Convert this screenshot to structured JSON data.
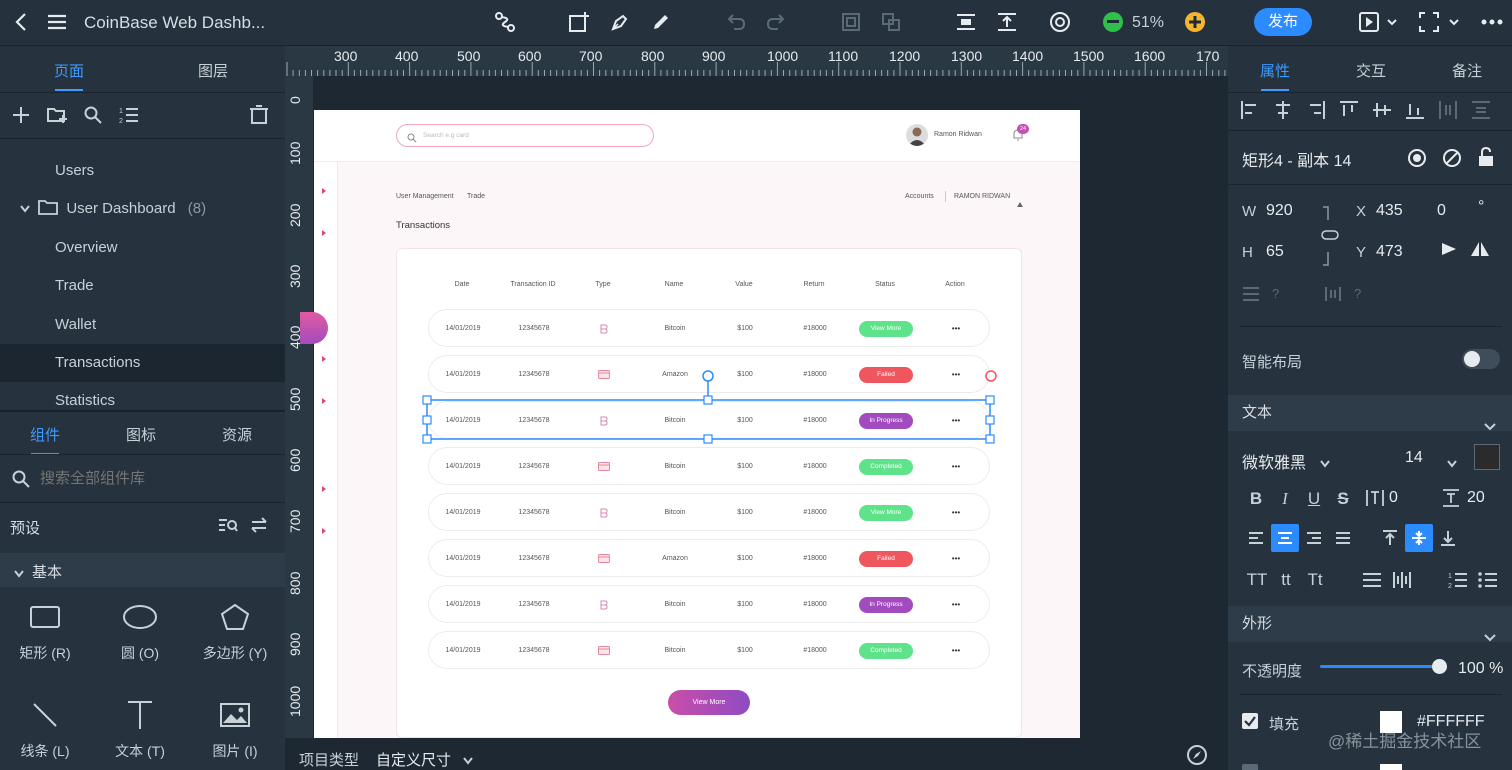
{
  "app": {
    "title": "CoinBase Web Dashb...",
    "zoom": "51%",
    "publish_label": "发布"
  },
  "left": {
    "tabs": [
      "页面",
      "图层"
    ],
    "pages": [
      {
        "label": "Users",
        "indent": 1
      },
      {
        "label": "User Dashboard",
        "count": "(8)",
        "folder": true
      },
      {
        "label": "Overview"
      },
      {
        "label": "Trade"
      },
      {
        "label": "Wallet"
      },
      {
        "label": "Transactions",
        "selected": true
      },
      {
        "label": "Statistics"
      }
    ],
    "lib_tabs": [
      "组件",
      "图标",
      "资源"
    ],
    "search_placeholder": "搜索全部组件库",
    "preset_label": "预设",
    "basic_label": "基本",
    "components": [
      {
        "label": "矩形 (R)",
        "icon": "rectangle-icon"
      },
      {
        "label": "圆 (O)",
        "icon": "ellipse-icon"
      },
      {
        "label": "多边形 (Y)",
        "icon": "polygon-icon"
      },
      {
        "label": "线条 (L)",
        "icon": "line-icon"
      },
      {
        "label": "文本 (T)",
        "icon": "text-icon"
      },
      {
        "label": "图片 (I)",
        "icon": "image-icon"
      }
    ]
  },
  "ruler": {
    "h": [
      "300",
      "400",
      "500",
      "600",
      "700",
      "800",
      "900",
      "1000",
      "1100",
      "1200",
      "1300",
      "1400",
      "1500",
      "1600",
      "170"
    ],
    "v": [
      "0",
      "100",
      "200",
      "300",
      "400",
      "500",
      "600",
      "700",
      "800",
      "900",
      "1000"
    ]
  },
  "bottom": {
    "project_type_label": "项目类型",
    "project_type_value": "自定义尺寸"
  },
  "right": {
    "tabs": [
      "属性",
      "交互",
      "备注"
    ],
    "layer_name": "矩形4 - 副本 14",
    "w_label": "W",
    "w": "920",
    "h_label": "H",
    "h": "65",
    "x_label": "X",
    "x": "435",
    "y_label": "Y",
    "y": "473",
    "rotation": "0",
    "rotation_unit": "°",
    "smart_layout": "智能布局",
    "text_section": "文本",
    "font_family": "微软雅黑",
    "font_size": "14",
    "letter_spacing": "0",
    "line_height": "20",
    "shape_section": "外形",
    "opacity_label": "不透明度",
    "opacity": "100 %",
    "opacity_fraction": 1.0,
    "fill_label": "填充",
    "fill_hex": "#FFFFFF",
    "watermark": "@稀土掘金技术社区"
  },
  "design": {
    "search_placeholder": "Search e.g card",
    "user_name": "Ramon Ridwan",
    "notif_count": "24",
    "breadcrumb_1": "User Management",
    "breadcrumb_2": "Trade",
    "accounts": "Accounts",
    "account_name": "RAMON RIDWAN",
    "section_title": "Transactions",
    "headers": [
      "Date",
      "Transaction ID",
      "Type",
      "Name",
      "Value",
      "Return",
      "Status",
      "Action"
    ],
    "rows": [
      {
        "date": "14/01/2019",
        "id": "12345678",
        "type": "bitcoin",
        "name": "Bitcoin",
        "value": "$100",
        "ret": "#18000",
        "status": "View More",
        "color": "#5ee38a"
      },
      {
        "date": "14/01/2019",
        "id": "12345678",
        "type": "card",
        "name": "Amazon",
        "value": "$100",
        "ret": "#18000",
        "status": "Failed",
        "color": "#f0565e"
      },
      {
        "date": "14/01/2019",
        "id": "12345678",
        "type": "bitcoin",
        "name": "Bitcoin",
        "value": "$100",
        "ret": "#18000",
        "status": "In Progress",
        "color": "#a24bbf"
      },
      {
        "date": "14/01/2019",
        "id": "12345678",
        "type": "card",
        "name": "Bitcoin",
        "value": "$100",
        "ret": "#18000",
        "status": "Completed",
        "color": "#5ee38a"
      },
      {
        "date": "14/01/2019",
        "id": "12345678",
        "type": "bitcoin",
        "name": "Bitcoin",
        "value": "$100",
        "ret": "#18000",
        "status": "View More",
        "color": "#5ee38a"
      },
      {
        "date": "14/01/2019",
        "id": "12345678",
        "type": "card",
        "name": "Amazon",
        "value": "$100",
        "ret": "#18000",
        "status": "Failed",
        "color": "#f0565e"
      },
      {
        "date": "14/01/2019",
        "id": "12345678",
        "type": "bitcoin",
        "name": "Bitcoin",
        "value": "$100",
        "ret": "#18000",
        "status": "In Progress",
        "color": "#a24bbf"
      },
      {
        "date": "14/01/2019",
        "id": "12345678",
        "type": "card",
        "name": "Bitcoin",
        "value": "$100",
        "ret": "#18000",
        "status": "Completed",
        "color": "#5ee38a"
      }
    ],
    "view_more": "View More",
    "action_glyph": "•••"
  }
}
